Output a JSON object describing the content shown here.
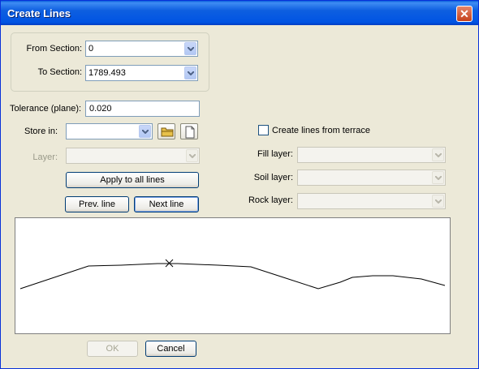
{
  "window": {
    "title": "Create Lines"
  },
  "sections": {
    "from_label": "From Section:",
    "from_value": "0",
    "to_label": "To Section:",
    "to_value": "1789.493"
  },
  "tolerance": {
    "label": "Tolerance (plane):",
    "value": "0.020"
  },
  "store": {
    "label": "Store in:",
    "value": ""
  },
  "layer": {
    "label": "Layer:",
    "value": ""
  },
  "buttons": {
    "apply_all": "Apply to all lines",
    "prev_line": "Prev. line",
    "next_line": "Next line",
    "ok": "OK",
    "cancel": "Cancel"
  },
  "terrace": {
    "checkbox_label": "Create lines from terrace",
    "checked": false,
    "fill_label": "Fill layer:",
    "soil_label": "Soil layer:",
    "rock_label": "Rock layer:"
  },
  "icons": [
    "close-icon",
    "folder-icon",
    "new-document-icon",
    "chevron-down-icon",
    "cross-marker-icon"
  ]
}
